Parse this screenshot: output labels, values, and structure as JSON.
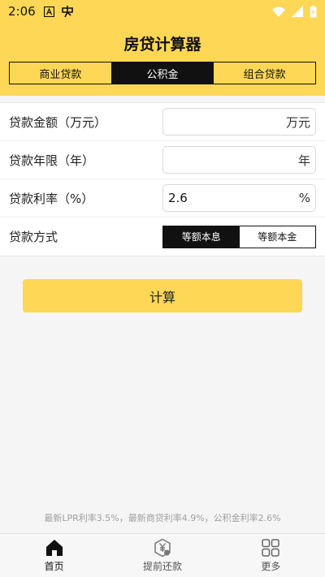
{
  "status_bar": {
    "time": "2:06",
    "left_icons": [
      "notification-a-icon",
      "chinese-char-icon"
    ],
    "right_icons": [
      "wifi-icon",
      "signal-icon",
      "battery-charging-icon"
    ]
  },
  "header": {
    "title": "房贷计算器",
    "background_color": "#fdd755"
  },
  "tabs": [
    {
      "label": "商业贷款",
      "active": false
    },
    {
      "label": "公积金",
      "active": true
    },
    {
      "label": "组合贷款",
      "active": false
    }
  ],
  "form": {
    "amount": {
      "label": "贷款金额（万元）",
      "value": "",
      "unit": "万元"
    },
    "years": {
      "label": "贷款年限（年）",
      "value": "",
      "unit": "年"
    },
    "rate": {
      "label": "贷款利率（%）",
      "value": "2.6",
      "unit": "%"
    },
    "method": {
      "label": "贷款方式",
      "options": [
        {
          "label": "等额本息",
          "active": true
        },
        {
          "label": "等额本金",
          "active": false
        }
      ]
    }
  },
  "calculate_button": {
    "label": "计算"
  },
  "footer_note": "最新LPR利率3.5%，最新商贷利率4.9%，公积金利率2.6%",
  "bottom_nav": [
    {
      "label": "首页",
      "icon": "home-icon",
      "active": true
    },
    {
      "label": "提前还款",
      "icon": "yuan-coin-icon",
      "active": false
    },
    {
      "label": "更多",
      "icon": "grid-icon",
      "active": false
    }
  ]
}
